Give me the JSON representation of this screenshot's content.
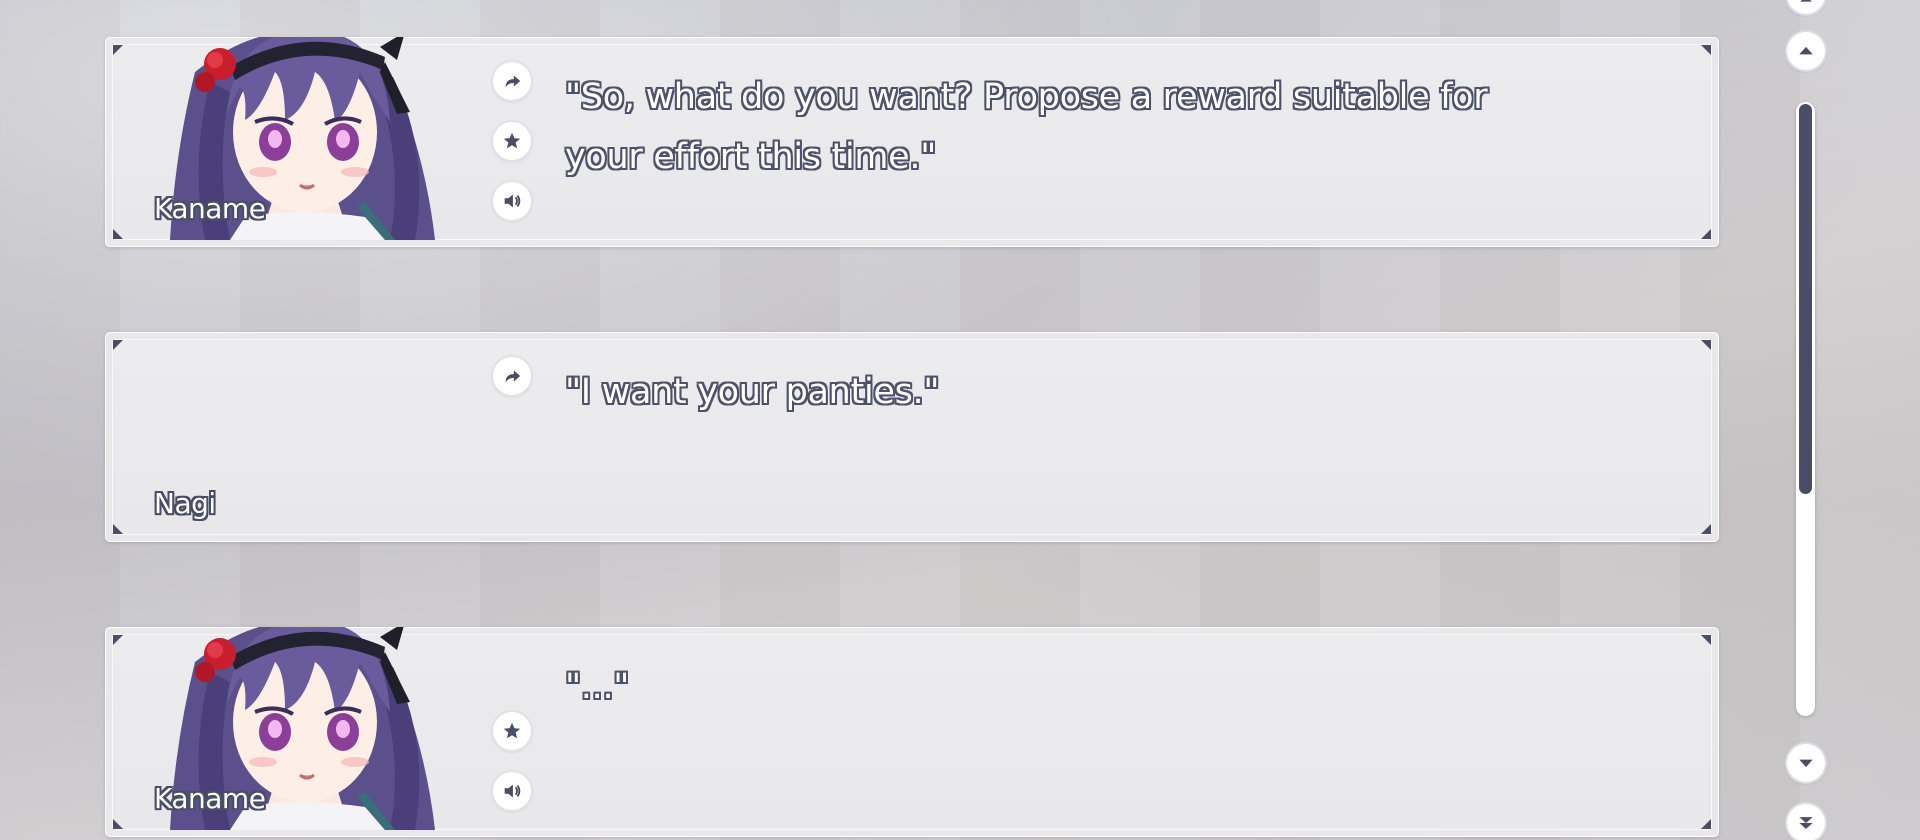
{
  "backlog": {
    "entries": [
      {
        "speaker": "Kaname",
        "text": "\"So, what do you want? Propose a reward suitable for your effort this time.\"",
        "has_portrait": true,
        "buttons": [
          "jump-icon",
          "star-icon",
          "voice-icon"
        ]
      },
      {
        "speaker": "Nagi",
        "text": "\"I want your panties.\"",
        "has_portrait": false,
        "buttons": [
          "jump-icon"
        ]
      },
      {
        "speaker": "Kaname",
        "text": "\"...\"",
        "has_portrait": true,
        "buttons": [
          "star-icon",
          "voice-icon"
        ]
      }
    ]
  },
  "scrollbar": {
    "position_fraction": 0.64,
    "buttons": [
      "page-up-icon",
      "arrow-up-icon",
      "arrow-down-icon",
      "page-down-icon"
    ]
  },
  "colors": {
    "accent": "#4a4d68",
    "panel": "#ebebed",
    "text_outline": "#4e516c"
  }
}
